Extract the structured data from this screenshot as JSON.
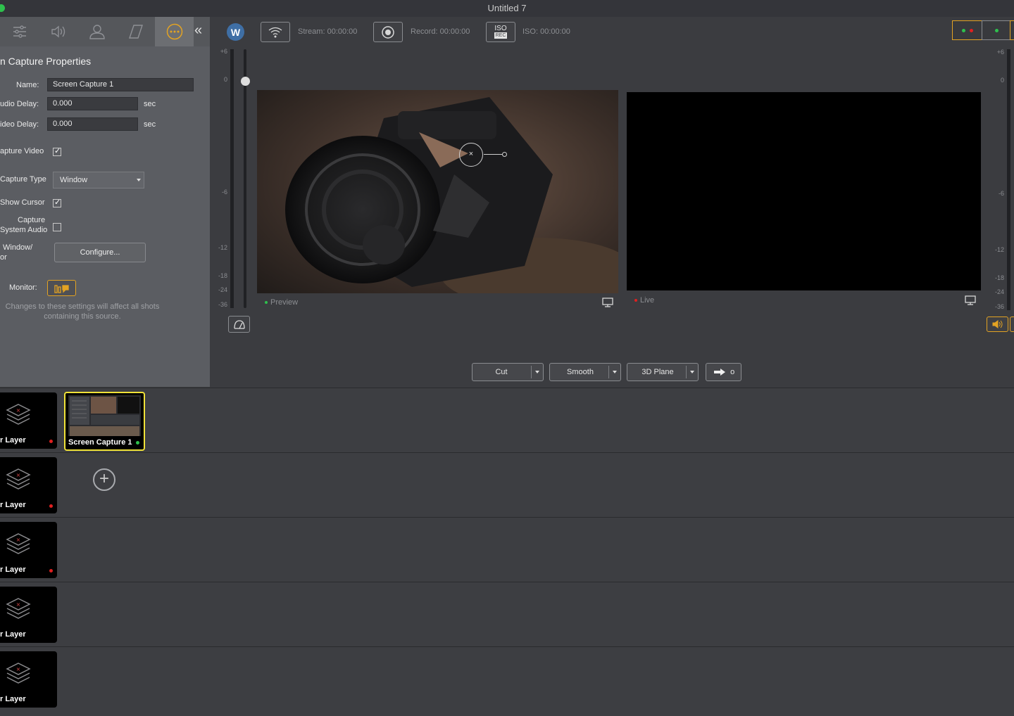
{
  "window": {
    "title": "Untitled 7"
  },
  "panel": {
    "title": "n Capture Properties",
    "name_label": "Name:",
    "name_value": "Screen Capture 1",
    "audio_delay_label": "udio Delay:",
    "audio_delay_value": "0.000",
    "audio_delay_unit": "sec",
    "video_delay_label": "ideo Delay:",
    "video_delay_value": "0.000",
    "video_delay_unit": "sec",
    "capture_video_label": "apture Video",
    "capture_type_label": "Capture Type",
    "capture_type_value": "Window",
    "show_cursor_label": "Show Cursor",
    "capture_system_audio_label_1": "Capture",
    "capture_system_audio_label_2": "System Audio",
    "window_label_1": "Window/",
    "window_label_2": "or",
    "configure_button": "Configure...",
    "monitor_label": "Monitor:",
    "note_line_1": "Changes to these settings will affect all shots",
    "note_line_2": "containing this source.",
    "checks": {
      "capture_video": true,
      "show_cursor": true,
      "capture_system_audio": false
    }
  },
  "toolbar": {
    "logo": "W",
    "stream_label": "Stream:",
    "stream_time": "00:00:00",
    "record_label": "Record:",
    "record_time": "00:00:00",
    "iso_badge_top": "ISO",
    "iso_badge_bottom": "REC",
    "iso_label": "ISO:",
    "iso_time": "00:00:00"
  },
  "meters": {
    "left_scale": [
      "+6",
      "0",
      "-6",
      "-12",
      "-18",
      "-24",
      "-36"
    ],
    "right_scale": [
      "+6",
      "0",
      "-6",
      "-12",
      "-18",
      "-24",
      "-36"
    ]
  },
  "monitors": {
    "preview_label": "Preview",
    "live_label": "Live"
  },
  "transitions": {
    "cut": "Cut",
    "smooth": "Smooth",
    "plane": "3D Plane",
    "go_symbol": "o"
  },
  "layers": [
    {
      "label": "r Layer",
      "live_dot": true
    },
    {
      "label": "r Layer",
      "live_dot": true
    },
    {
      "label": "r Layer",
      "live_dot": true
    },
    {
      "label": "r Layer",
      "live_dot": false
    },
    {
      "label": "r Layer",
      "live_dot": false
    }
  ],
  "shots": [
    {
      "label": "Screen Capture 1"
    }
  ],
  "colors": {
    "accent": "#e3a323",
    "selection": "#f0e238",
    "live_red": "#e02020",
    "ok_green": "#2ec14d"
  },
  "icons": [
    "sliders-icon",
    "speaker-icon",
    "person-icon",
    "crop-icon",
    "more-icon",
    "collapse-icon",
    "wifi-icon",
    "record-icon",
    "iso-rec-icon",
    "display-icon",
    "audio-icon",
    "layers-icon",
    "plus-icon",
    "arrow-right-icon"
  ]
}
